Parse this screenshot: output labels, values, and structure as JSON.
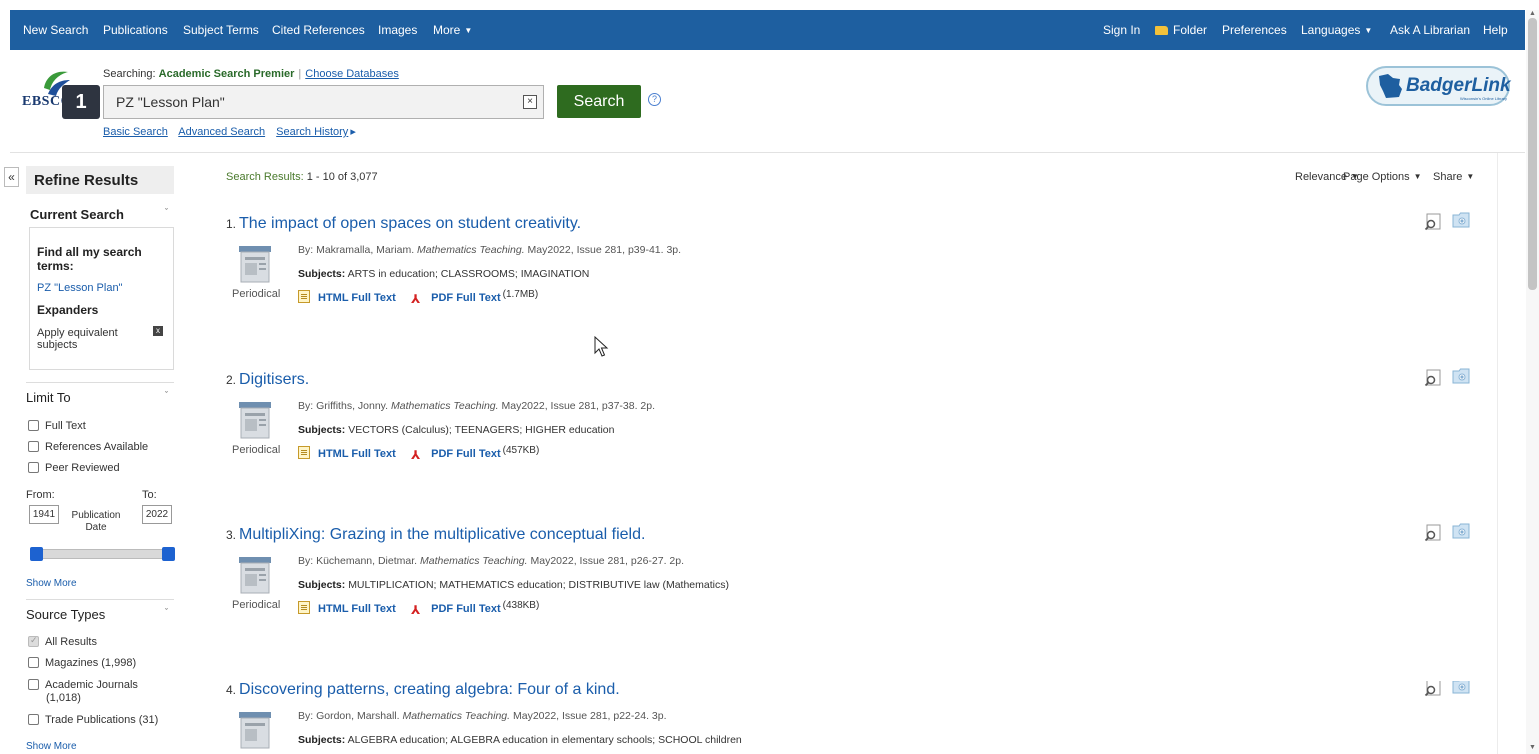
{
  "topnav": {
    "left_items": [
      "New Search",
      "Publications",
      "Subject Terms",
      "Cited References",
      "Images",
      "More"
    ],
    "right_items": [
      "Sign In",
      "Folder",
      "Preferences",
      "Languages",
      "Ask A Librarian",
      "Help"
    ],
    "bg_color": "#1e5fa0"
  },
  "header": {
    "logo_text": "EBSCO",
    "step_badge": "1",
    "searching_label": "Searching:",
    "database": "Academic Search Premier",
    "choose_databases": "Choose Databases",
    "query": "PZ \"Lesson Plan\"",
    "clear_glyph": "×",
    "search_button": "Search",
    "help_glyph": "?",
    "links": [
      "Basic Search",
      "Advanced Search",
      "Search History"
    ],
    "history_arrow": "▸",
    "partner_logo": "BadgerLink",
    "partner_sub": "Wisconsin's Online Library"
  },
  "sidebar": {
    "collapse_glyph": "«",
    "refine_title": "Refine Results",
    "current_search": {
      "heading": "Current Search",
      "find_label": "Find all my search terms:",
      "term": "PZ \"Lesson Plan\"",
      "expanders_label": "Expanders",
      "expander_item": "Apply equivalent subjects",
      "remove_glyph": "x"
    },
    "limit_to": {
      "heading": "Limit To",
      "options": [
        "Full Text",
        "References Available",
        "Peer Reviewed"
      ],
      "from_label": "From:",
      "to_label": "To:",
      "from_year": "1941",
      "to_year": "2022",
      "date_label": "Publication Date",
      "range_min_fraction": 0.0,
      "range_max_fraction": 1.0
    },
    "show_more": "Show More",
    "source_types": {
      "heading": "Source Types",
      "all_results": "All Results",
      "options": [
        "Magazines (1,998)",
        "Academic Journals",
        "(1,018)",
        "Trade Publications (31)"
      ]
    },
    "show_more_2": "Show More",
    "chevron_glyph": "ˇ"
  },
  "results": {
    "count_label": "Search Results:",
    "count_value": "1 - 10 of 3,077",
    "controls": [
      "Relevance",
      "Page Options",
      "Share"
    ],
    "items": [
      {
        "index": "1.",
        "title": "The impact of open spaces on student creativity.",
        "by": "By: Makramalla, Mariam.",
        "source": "Mathematics Teaching.",
        "details": "May2022, Issue 281, p39-41. 3p.",
        "subjects_label": "Subjects:",
        "subjects": "ARTS in education; CLASSROOMS; IMAGINATION",
        "type": "Periodical",
        "html_link": "HTML Full Text",
        "pdf_link": "PDF Full Text",
        "pdf_size": "(1.7MB)"
      },
      {
        "index": "2.",
        "title": "Digitisers.",
        "by": "By: Griffiths, Jonny.",
        "source": "Mathematics Teaching.",
        "details": "May2022, Issue 281, p37-38. 2p.",
        "subjects_label": "Subjects:",
        "subjects": "VECTORS (Calculus); TEENAGERS; HIGHER education",
        "type": "Periodical",
        "html_link": "HTML Full Text",
        "pdf_link": "PDF Full Text",
        "pdf_size": "(457KB)"
      },
      {
        "index": "3.",
        "title": "MultipliXing: Grazing in the multiplicative conceptual field.",
        "by": "By: Küchemann, Dietmar.",
        "source": "Mathematics Teaching.",
        "details": "May2022, Issue 281, p26-27. 2p.",
        "subjects_label": "Subjects:",
        "subjects": "MULTIPLICATION; MATHEMATICS education; DISTRIBUTIVE law (Mathematics)",
        "type": "Periodical",
        "html_link": "HTML Full Text",
        "pdf_link": "PDF Full Text",
        "pdf_size": "(438KB)"
      },
      {
        "index": "4.",
        "title": "Discovering patterns, creating algebra: Four of a kind.",
        "by": "By: Gordon, Marshall.",
        "source": "Mathematics Teaching.",
        "details": "May2022, Issue 281, p22-24. 3p.",
        "subjects_label": "Subjects:",
        "subjects": "ALGEBRA education; ALGEBRA education in elementary schools; SCHOOL children",
        "type": "",
        "html_link": "",
        "pdf_link": "",
        "pdf_size": ""
      }
    ]
  },
  "colors": {
    "link": "#1a5dab",
    "search_button": "#2e6b1f",
    "database_name": "#2a6a2a",
    "slider_handle": "#1d62d0"
  }
}
